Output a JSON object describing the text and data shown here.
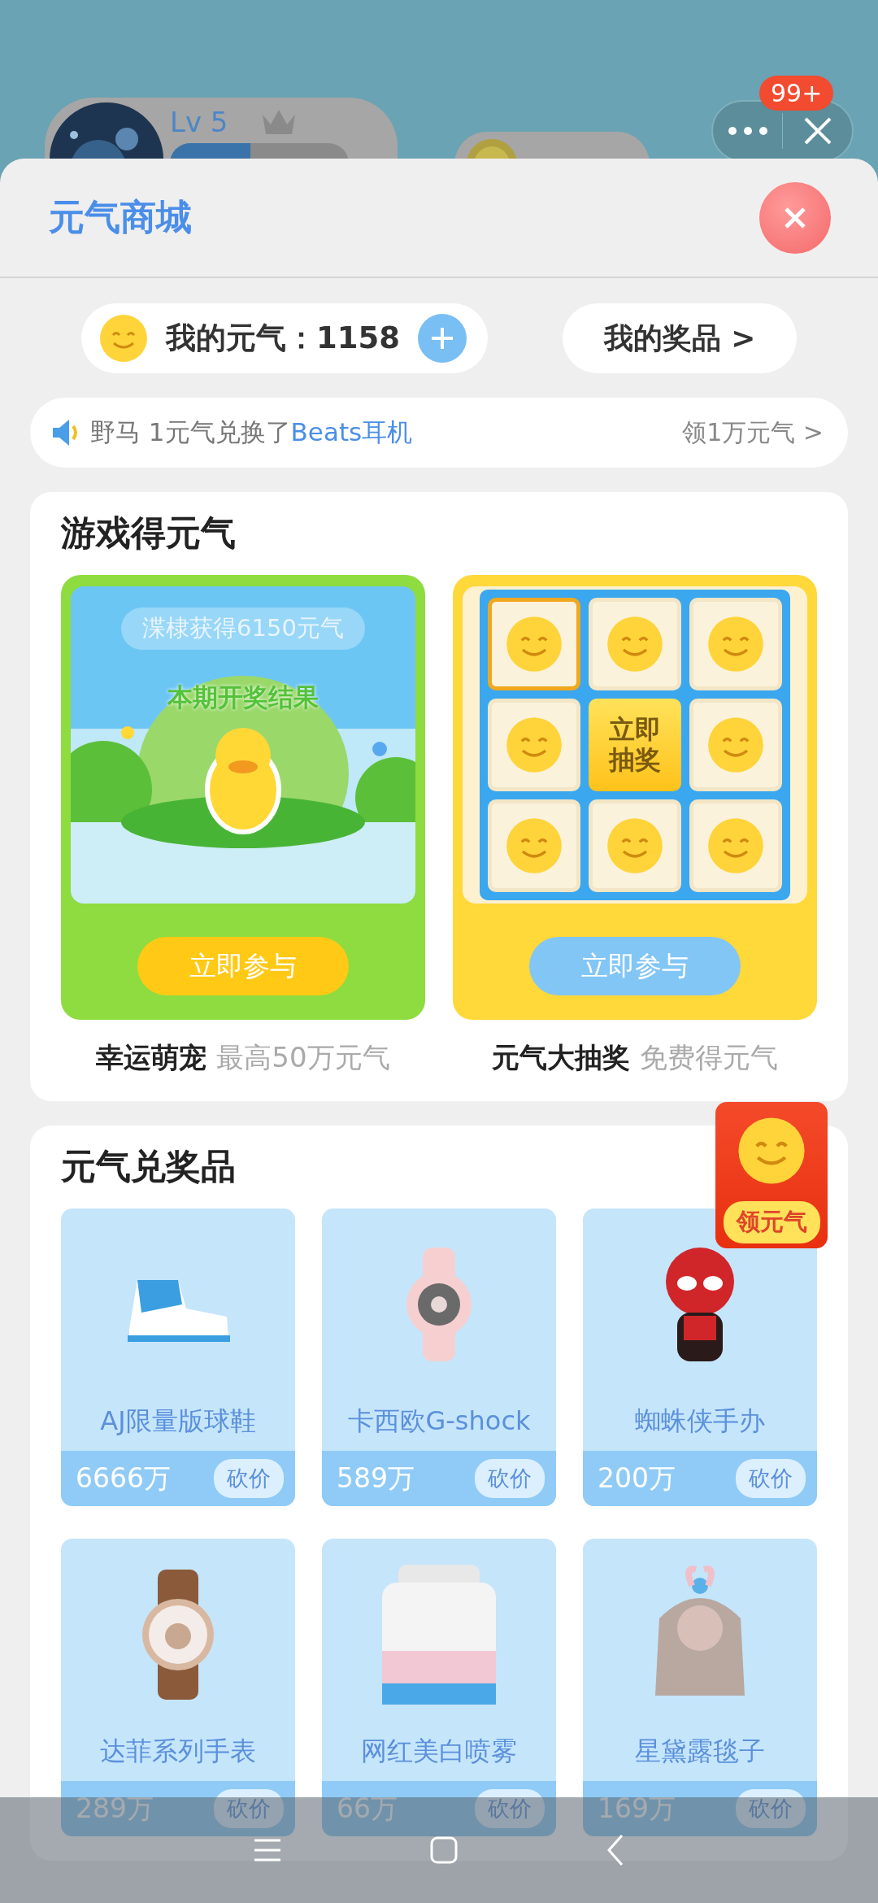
{
  "background": {
    "level_label": "Lv 5",
    "notification_badge": "99+"
  },
  "header": {
    "title": "元气商城"
  },
  "balance": {
    "label": "我的元气：",
    "value": "1158"
  },
  "my_prizes": "我的奖品 >",
  "ticker": {
    "text": "野马 1元气兑换了",
    "item": "Beats耳机",
    "link": "领1万元气 >"
  },
  "games": {
    "title": "游戏得元气",
    "items": [
      {
        "kind": "pet",
        "banner": "渫棣获得6150元气",
        "caption": "本期开奖结果",
        "button": "立即参与",
        "name": "幸运萌宠",
        "subtitle": "最高50万元气"
      },
      {
        "kind": "lottery",
        "center": "立即抽奖",
        "cells": [
          {
            "selected": true
          },
          {
            "selected": false
          },
          {
            "selected": false
          },
          {
            "selected": false
          },
          {
            "selected": false
          },
          {
            "selected": false
          },
          {
            "selected": false
          },
          {
            "selected": false
          }
        ],
        "button": "立即参与",
        "name": "元气大抽奖",
        "subtitle": "免费得元气"
      }
    ]
  },
  "prizes": {
    "title": "元气兑奖品",
    "items": [
      {
        "name": "AJ限量版球鞋",
        "price": "6666万",
        "action": "砍价"
      },
      {
        "name": "卡西欧G-shock",
        "price": "589万",
        "action": "砍价"
      },
      {
        "name": "蜘蛛侠手办",
        "price": "200万",
        "action": "砍价"
      },
      {
        "name": "达菲系列手表",
        "price": "289万",
        "action": "砍价"
      },
      {
        "name": "网红美白喷雾",
        "price": "66万",
        "action": "砍价"
      },
      {
        "name": "星黛露毯子",
        "price": "169万",
        "action": "砍价"
      }
    ]
  },
  "red_packet": {
    "label": "领元气"
  }
}
